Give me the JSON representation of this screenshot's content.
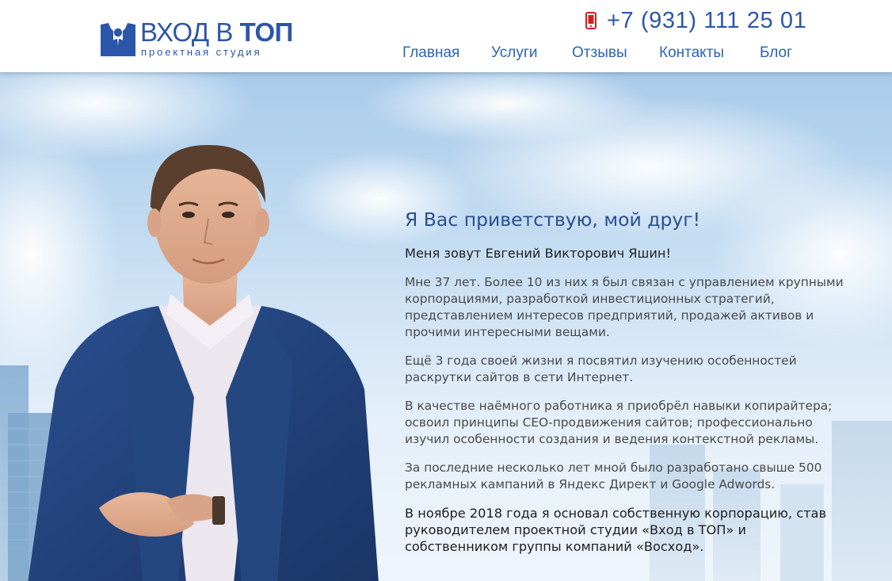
{
  "header": {
    "logo": {
      "title_part1": "ВХОД В",
      "title_part2": "ТОП",
      "subtitle": "проектная студия"
    },
    "phone": {
      "icon": "mobile-phone-icon",
      "number": "+7 (931) 111 25 01"
    },
    "nav": [
      {
        "label": "Главная"
      },
      {
        "label": "Услуги"
      },
      {
        "label": "Отзывы"
      },
      {
        "label": "Контакты"
      },
      {
        "label": "Блог"
      }
    ]
  },
  "hero": {
    "greeting": "Я Вас приветствую, мой друг!",
    "paragraphs": [
      "Меня зовут Евгений Викторович Яшин!",
      "Мне 37 лет. Более 10 из них я был связан с управлением крупными корпорациями, разработкой инвестиционных стратегий, представлением интересов предприятий, продажей активов и прочими интересными вещами.",
      "Ещё 3 года своей жизни я посвятил изучению особенностей раскрутки сайтов в сети Интернет.",
      "В качестве наёмного работника я приобрёл навыки копирайтера; освоил принципы СЕО-продвижения сайтов; профессионально изучил особенности создания и ведения контекстной рекламы.",
      "За последние несколько лет мной было разработано свыше 500 рекламных кампаний в Яндекс Директ и Google Adwords.",
      "В ноябре 2018 года я основал собственную корпорацию, став руководителем проектной студии «Вход в ТОП» и собственником группы компаний «Восход»."
    ]
  },
  "colors": {
    "brand_blue": "#2c56a8",
    "nav_blue": "#2c64b8",
    "heading_blue": "#2a4f92",
    "phone_icon_red": "#d0201e"
  }
}
